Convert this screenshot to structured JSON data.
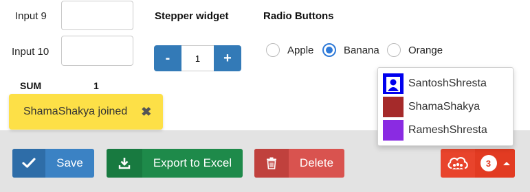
{
  "form": {
    "input9_label": "Input 9",
    "input9_value": "",
    "input10_label": "Input 10",
    "input10_value": "",
    "sum_label": "SUM",
    "sum_value": "1"
  },
  "stepper": {
    "title": "Stepper widget",
    "value": "1",
    "minus": "-",
    "plus": "+"
  },
  "radios": {
    "title": "Radio Buttons",
    "options": [
      {
        "label": "Apple",
        "checked": false
      },
      {
        "label": "Banana",
        "checked": true
      },
      {
        "label": "Orange",
        "checked": false
      }
    ]
  },
  "toast": {
    "text": "ShamaShakya joined",
    "close": "✖"
  },
  "toolbar": {
    "save_label": "Save",
    "export_label": "Export to Excel",
    "delete_label": "Delete"
  },
  "notifications": {
    "count": "3",
    "users": [
      {
        "name": "SantoshShresta",
        "avatar_color": "#0000ee",
        "icon": "person-icon"
      },
      {
        "name": "ShamaShakya",
        "avatar_color": "#a52a2a",
        "icon": "none"
      },
      {
        "name": "RameshShresta",
        "avatar_color": "#8a2be2",
        "icon": "none"
      }
    ]
  },
  "colors": {
    "primary": "#337ab7",
    "success": "#1e8a4a",
    "danger": "#d9534f",
    "toast": "#fde047",
    "notify": "#e8442c"
  }
}
